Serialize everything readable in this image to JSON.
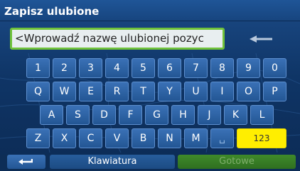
{
  "title": "Zapisz ulubione",
  "input": {
    "value": "<Wprowadź nazwę ulubionej pozyс"
  },
  "keys": {
    "row1": [
      "1",
      "2",
      "3",
      "4",
      "5",
      "6",
      "7",
      "8",
      "9",
      "0"
    ],
    "row2": [
      "Q",
      "W",
      "E",
      "R",
      "T",
      "Y",
      "U",
      "I",
      "O",
      "P"
    ],
    "row3": [
      "A",
      "S",
      "D",
      "F",
      "G",
      "H",
      "J",
      "K",
      "L"
    ],
    "row4": [
      "Z",
      "X",
      "C",
      "V",
      "B",
      "N",
      "M"
    ],
    "space": "␣",
    "numeric": "123"
  },
  "bottom": {
    "keyboard_label": "Klawiatura",
    "done_label": "Gotowe"
  },
  "colors": {
    "accent_green": "#6fc23a",
    "key_yellow": "#ffee00",
    "background_blue": "#0f3566"
  },
  "icons": {
    "backspace": "arrow-left-icon",
    "back": "return-arrow-icon"
  }
}
